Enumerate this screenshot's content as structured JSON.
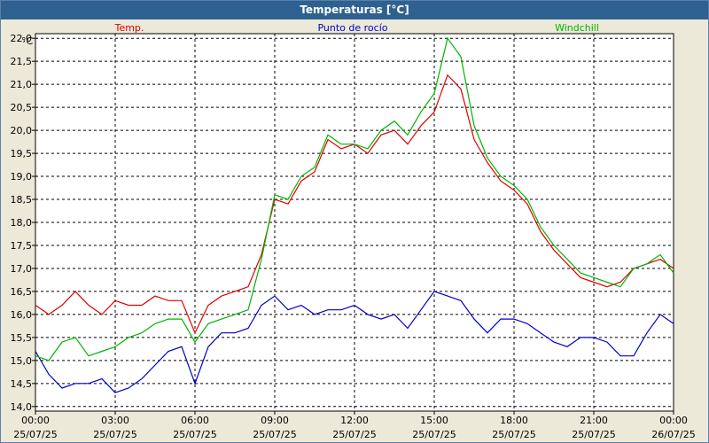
{
  "window": {
    "title": "Temperaturas [°C]"
  },
  "chart_data": {
    "type": "line",
    "title": "Temperaturas [°C]",
    "ylabel": "°C",
    "ylim": [
      13.9,
      22.1
    ],
    "xlim_hours": [
      0,
      24
    ],
    "grid": true,
    "legend_position": "top",
    "yticks": [
      "22,0",
      "21,5",
      "21,0",
      "20,5",
      "20,0",
      "19,5",
      "19,0",
      "18,5",
      "18,0",
      "17,5",
      "17,0",
      "16,5",
      "16,0",
      "15,5",
      "15,0",
      "14,5",
      "14,0"
    ],
    "ytick_values": [
      22.0,
      21.5,
      21.0,
      20.5,
      20.0,
      19.5,
      19.0,
      18.5,
      18.0,
      17.5,
      17.0,
      16.5,
      16.0,
      15.5,
      15.0,
      14.5,
      14.0
    ],
    "xticks": [
      {
        "time": "00:00",
        "date": "25/07/25"
      },
      {
        "time": "03:00",
        "date": "25/07/25"
      },
      {
        "time": "06:00",
        "date": "25/07/25"
      },
      {
        "time": "09:00",
        "date": "25/07/25"
      },
      {
        "time": "12:00",
        "date": "25/07/25"
      },
      {
        "time": "15:00",
        "date": "25/07/25"
      },
      {
        "time": "18:00",
        "date": "25/07/25"
      },
      {
        "time": "21:00",
        "date": "25/07/25"
      },
      {
        "time": "00:00",
        "date": "26/07/25"
      }
    ],
    "x_hours": [
      0,
      0.5,
      1,
      1.5,
      2,
      2.5,
      3,
      3.5,
      4,
      4.5,
      5,
      5.5,
      6,
      6.5,
      7,
      7.5,
      8,
      8.5,
      9,
      9.5,
      10,
      10.5,
      11,
      11.5,
      12,
      12.5,
      13,
      13.5,
      14,
      14.5,
      15,
      15.5,
      16,
      16.5,
      17,
      17.5,
      18,
      18.5,
      19,
      19.5,
      20,
      20.5,
      21,
      21.5,
      22,
      22.5,
      23,
      23.5,
      24
    ],
    "series": [
      {
        "name": "Temp.",
        "color": "#e00000",
        "values": [
          16.2,
          16.0,
          16.2,
          16.5,
          16.2,
          16.0,
          16.3,
          16.2,
          16.2,
          16.4,
          16.3,
          16.3,
          15.6,
          16.2,
          16.4,
          16.5,
          16.6,
          17.3,
          18.5,
          18.4,
          18.9,
          19.1,
          19.8,
          19.6,
          19.7,
          19.5,
          19.9,
          20.0,
          19.7,
          20.1,
          20.4,
          21.2,
          20.9,
          19.8,
          19.3,
          18.9,
          18.7,
          18.4,
          17.8,
          17.4,
          17.1,
          16.8,
          16.7,
          16.6,
          16.7,
          17.0,
          17.1,
          17.2,
          17.0
        ]
      },
      {
        "name": "Punto de rocío",
        "color": "#0000c8",
        "values": [
          15.2,
          14.7,
          14.4,
          14.5,
          14.5,
          14.6,
          14.3,
          14.4,
          14.6,
          14.9,
          15.2,
          15.3,
          14.5,
          15.3,
          15.6,
          15.6,
          15.7,
          16.2,
          16.4,
          16.1,
          16.2,
          16.0,
          16.1,
          16.1,
          16.2,
          16.0,
          15.9,
          16.0,
          15.7,
          16.1,
          16.5,
          16.4,
          16.3,
          15.9,
          15.6,
          15.9,
          15.9,
          15.8,
          15.6,
          15.4,
          15.3,
          15.5,
          15.5,
          15.4,
          15.1,
          15.1,
          15.6,
          16.0,
          15.8
        ]
      },
      {
        "name": "Windchill",
        "color": "#00b400",
        "values": [
          15.1,
          15.0,
          15.4,
          15.5,
          15.1,
          15.2,
          15.3,
          15.5,
          15.6,
          15.8,
          15.9,
          15.9,
          15.4,
          15.8,
          15.9,
          16.0,
          16.1,
          17.2,
          18.6,
          18.5,
          19.0,
          19.2,
          19.9,
          19.7,
          19.7,
          19.6,
          20.0,
          20.2,
          19.9,
          20.4,
          20.8,
          22.0,
          21.6,
          20.1,
          19.4,
          19.0,
          18.8,
          18.5,
          17.9,
          17.5,
          17.2,
          16.9,
          16.8,
          16.7,
          16.6,
          17.0,
          17.1,
          17.3,
          16.9
        ]
      }
    ]
  }
}
